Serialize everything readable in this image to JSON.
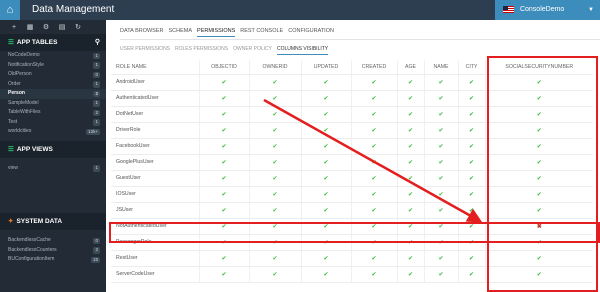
{
  "header": {
    "home_icon": "home-icon",
    "title": "Data Management",
    "account": "ConsoleDemo"
  },
  "sidebar": {
    "toolbar": [
      "+",
      "▦",
      "⚙",
      "▤",
      "↻"
    ],
    "tables_header": "APP TABLES",
    "tables": [
      {
        "name": "NoCodeDemo",
        "count": "1"
      },
      {
        "name": "NotificationStyle",
        "count": "1"
      },
      {
        "name": "OldPerson",
        "count": "0"
      },
      {
        "name": "Order",
        "count": "1"
      },
      {
        "name": "Person",
        "count": "2"
      },
      {
        "name": "SampleModel",
        "count": "1"
      },
      {
        "name": "TableWithFiles",
        "count": "2"
      },
      {
        "name": "Test",
        "count": "1"
      },
      {
        "name": "worldcities",
        "count": "12k+"
      }
    ],
    "views_header": "APP VIEWS",
    "views": [
      {
        "name": "view",
        "count": "1"
      }
    ],
    "system_header": "SYSTEM DATA",
    "system": [
      {
        "name": "BackendlessCache",
        "count": "0"
      },
      {
        "name": "BackendlessCounters",
        "count": "2"
      },
      {
        "name": "BUConfigurationItem",
        "count": "15"
      }
    ]
  },
  "tabs": [
    "DATA BROWSER",
    "SCHEMA",
    "PERMISSIONS",
    "REST CONSOLE",
    "CONFIGURATION"
  ],
  "active_tab": 2,
  "subtabs": [
    "USER PERMISSIONS",
    "ROLES PERMISSIONS",
    "OWNER POLICY",
    "COLUMNS VISIBILITY"
  ],
  "active_subtab": 3,
  "table": {
    "columns": [
      "ROLE NAME",
      "OBJECTID",
      "OWNERID",
      "UPDATED",
      "CREATED",
      "AGE",
      "NAME",
      "CITY",
      "SOCIALSECURITYNUMBER"
    ],
    "rows": [
      {
        "role": "AndroidUser",
        "cells": [
          1,
          1,
          1,
          1,
          1,
          1,
          1,
          1
        ]
      },
      {
        "role": "AuthenticatedUser",
        "cells": [
          1,
          1,
          1,
          1,
          1,
          1,
          1,
          1
        ]
      },
      {
        "role": "DotNetUser",
        "cells": [
          1,
          1,
          1,
          1,
          1,
          1,
          1,
          1
        ]
      },
      {
        "role": "DriverRole",
        "cells": [
          1,
          1,
          1,
          1,
          1,
          1,
          1,
          1
        ]
      },
      {
        "role": "FacebookUser",
        "cells": [
          1,
          1,
          1,
          1,
          1,
          1,
          1,
          1
        ]
      },
      {
        "role": "GooglePlusUser",
        "cells": [
          1,
          1,
          1,
          1,
          1,
          1,
          1,
          1
        ]
      },
      {
        "role": "GuestUser",
        "cells": [
          1,
          1,
          1,
          1,
          1,
          1,
          1,
          1
        ]
      },
      {
        "role": "IOSUser",
        "cells": [
          1,
          1,
          1,
          1,
          1,
          1,
          1,
          1
        ]
      },
      {
        "role": "JSUser",
        "cells": [
          1,
          1,
          1,
          1,
          1,
          1,
          1,
          1
        ]
      },
      {
        "role": "NotAuthenticatedUser",
        "cells": [
          1,
          1,
          1,
          1,
          1,
          1,
          1,
          0
        ]
      },
      {
        "role": "PassengerRole",
        "cells": [
          1,
          1,
          1,
          1,
          1,
          1,
          1,
          1
        ]
      },
      {
        "role": "RestUser",
        "cells": [
          1,
          1,
          1,
          1,
          1,
          1,
          1,
          1
        ]
      },
      {
        "role": "ServerCodeUser",
        "cells": [
          1,
          1,
          1,
          1,
          1,
          1,
          1,
          1
        ]
      }
    ]
  },
  "colors": {
    "check": "#3cbc3c",
    "cross": "#c0392b",
    "highlight": "#e41e1e",
    "accent": "#3c8dbc"
  }
}
